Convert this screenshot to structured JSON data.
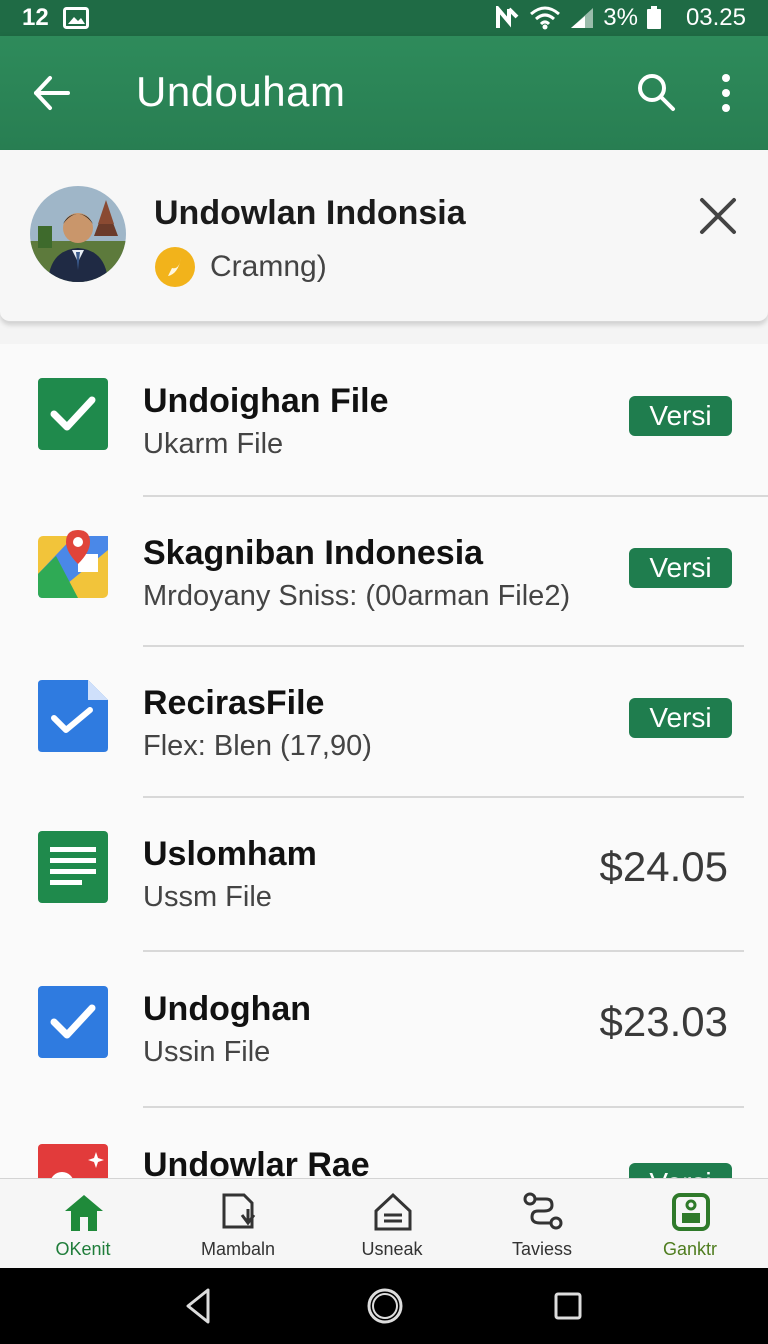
{
  "status_bar": {
    "left_text": "12",
    "battery": "3%",
    "time": "03.25"
  },
  "app_bar": {
    "title": "Undouham"
  },
  "profile": {
    "name": "Undowlan Indonsia",
    "status": "Cramng)"
  },
  "files": [
    {
      "name": "Undoighan File",
      "subtitle": "Ukarm File",
      "badge": "Versi",
      "icon": "checkbox-green-icon"
    },
    {
      "name": "Skagniban Indonesia",
      "subtitle": "Mrdoyany Sniss: (00arman File2)",
      "badge": "Versi",
      "icon": "maps-pin-icon"
    },
    {
      "name": "RecirasFile",
      "subtitle": "Flex: Blen (17,90)",
      "badge": "Versi",
      "icon": "blue-doc-icon"
    },
    {
      "name": "Uslomham",
      "subtitle": "Ussm File",
      "price": "$24.05",
      "icon": "green-sheet-icon"
    },
    {
      "name": "Undoghan",
      "subtitle": "Ussin File",
      "price": "$23.03",
      "icon": "checkbox-blue-icon"
    },
    {
      "name": "Undowlar Rae",
      "subtitle": "",
      "badge": "Versi",
      "icon": "red-photo-icon"
    }
  ],
  "bottom_nav": [
    {
      "label": "OKenit",
      "icon": "home-icon"
    },
    {
      "label": "Mambaln",
      "icon": "document-download-icon"
    },
    {
      "label": "Usneak",
      "icon": "house-outline-icon"
    },
    {
      "label": "Taviess",
      "icon": "route-icon"
    },
    {
      "label": "Ganktr",
      "icon": "wallet-icon"
    }
  ],
  "colors": {
    "primary": "#2e8b5b",
    "status_bar": "#1f6b45",
    "badge": "#1f7d4e"
  }
}
